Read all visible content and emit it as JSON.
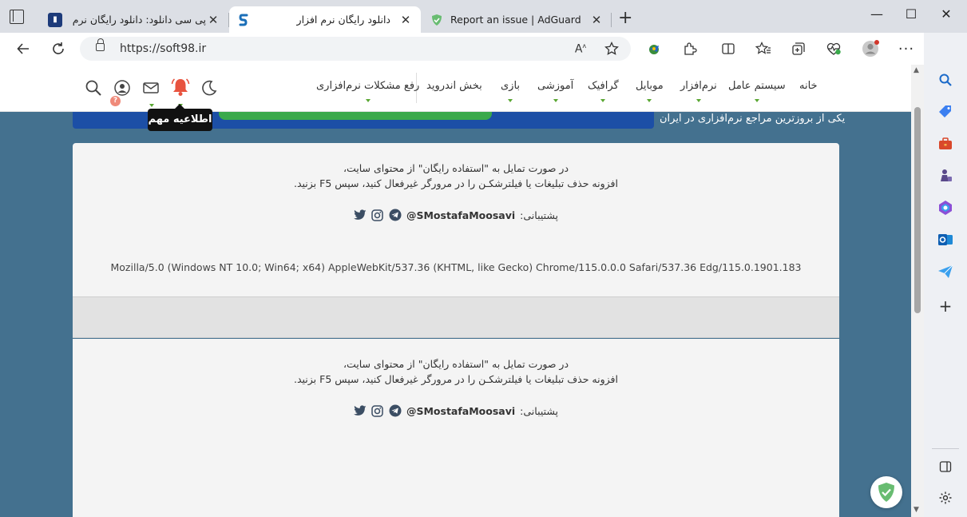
{
  "browser": {
    "tabs": [
      {
        "title": "پی سی دانلود: دانلود رایگان نرم افزا",
        "favicon_color": "#1d3b7a",
        "active": false
      },
      {
        "title": "دانلود رایگان نرم افزار",
        "favicon_color": "#1b6fb8",
        "active": true
      },
      {
        "title": "Report an issue | AdGuard",
        "favicon_color": "#68bc71",
        "active": false
      }
    ],
    "tab_close_glyph": "✕",
    "new_tab_glyph": "+",
    "window_controls": {
      "minimize": "—",
      "maximize": "☐",
      "close": "✕"
    },
    "address": {
      "url": "https://soft98.ir"
    },
    "toolbar_icons": [
      "back-icon",
      "refresh-icon",
      "read-aloud-icon",
      "favorite-star-icon",
      "extension-idm-icon",
      "extensions-icon",
      "split-screen-icon",
      "favorites-icon",
      "collections-icon",
      "performance-icon",
      "profile-icon",
      "more-icon",
      "bing-icon"
    ]
  },
  "site": {
    "nav": [
      {
        "label": "خانه",
        "has_caret": false
      },
      {
        "label": "سیستم عامل",
        "has_caret": true
      },
      {
        "label": "نرم‌افزار",
        "has_caret": true
      },
      {
        "label": "موبایل",
        "has_caret": true
      },
      {
        "label": "گرافیک",
        "has_caret": true
      },
      {
        "label": "آموزشی",
        "has_caret": true
      },
      {
        "label": "بازی",
        "has_caret": true
      },
      {
        "label": "بخش اندروید",
        "has_caret": false
      },
      {
        "label": "رفع مشکلات نرم‌افزاری",
        "has_caret": true
      }
    ],
    "header_icons": [
      "moon-icon",
      "bell-icon",
      "mail-icon",
      "user-icon",
      "search-icon"
    ],
    "user_badge": "?",
    "tooltip": "اطلاعیه مهم",
    "tagline": "یکی از بروزترین مراجع نرم‌افزاری در ایران",
    "accent_color": "#5aa733",
    "bell_color": "#e8533f"
  },
  "notice": {
    "line1": "در صورت تمایل به \"استفاده رایگان\" از محتوای سایت،",
    "line2": "افزونه حذف تبلیغات یا فیلترشکـن را در مرورگر غیرفعال کنید، سپس F5 بزنید.",
    "support_label": "پشتیبانی:",
    "support_handle": "@SMostafaMoosavi",
    "social_icons": [
      "telegram-icon",
      "instagram-icon",
      "twitter-icon"
    ],
    "user_agent": "Mozilla/5.0 (Windows NT 10.0; Win64; x64) AppleWebKit/537.36 (KHTML, like Gecko) Chrome/115.0.0.0 Safari/537.36 Edg/115.0.1901.183"
  },
  "edge_sidebar": [
    "search-icon",
    "shopping-tag-icon",
    "tools-icon",
    "games-icon",
    "microsoft365-icon",
    "outlook-icon",
    "telegram-send-icon",
    "add-icon",
    "sidebar-layout-icon",
    "settings-icon"
  ]
}
